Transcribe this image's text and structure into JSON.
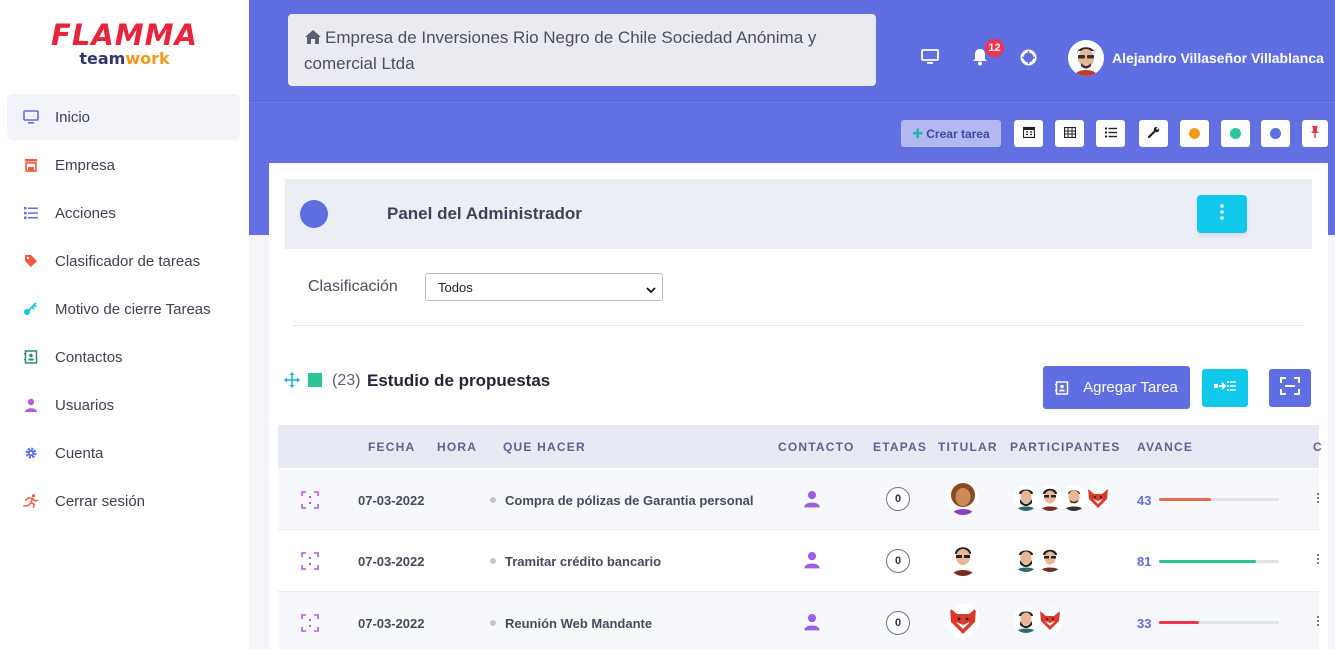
{
  "logo": {
    "brand": "FLAMMA",
    "sub_a": "team",
    "sub_b": "work"
  },
  "sidebar": {
    "items": [
      {
        "label": "Inicio",
        "icon": "monitor-icon",
        "active": true
      },
      {
        "label": "Empresa",
        "icon": "store-icon"
      },
      {
        "label": "Acciones",
        "icon": "list-icon"
      },
      {
        "label": "Clasificador de tareas",
        "icon": "tag-icon"
      },
      {
        "label": "Motivo de cierre Tareas",
        "icon": "key-icon"
      },
      {
        "label": "Contactos",
        "icon": "address-book-icon"
      },
      {
        "label": "Usuarios",
        "icon": "user-icon"
      },
      {
        "label": "Cuenta",
        "icon": "gear-icon"
      },
      {
        "label": "Cerrar sesión",
        "icon": "running-icon"
      }
    ]
  },
  "header": {
    "company": "Empresa de Inversiones Rio Negro de Chile Sociedad Anónima y comercial Ltda",
    "notifications_count": "12",
    "user_name": "Alejandro Villaseñor Villablanca"
  },
  "toolbar": {
    "create_task": "Crear tarea",
    "colors": {
      "accent": "#5f6ee0",
      "orange": "#f39a1d",
      "green": "#2bc59a",
      "blue": "#5f6ee0",
      "red": "#f0334f"
    }
  },
  "panel": {
    "title": "Panel del Administrador"
  },
  "filter": {
    "label": "Clasificación",
    "selected": "Todos"
  },
  "group": {
    "count": "(23)",
    "name": "Estudio de propuestas",
    "add_task": "Agregar Tarea"
  },
  "table": {
    "headers": [
      "FECHA",
      "HORA",
      "QUE HACER",
      "CONTACTO",
      "ETAPAS",
      "TITULAR",
      "PARTICIPANTES",
      "AVANCE",
      "C"
    ],
    "rows": [
      {
        "date": "07-03-2022",
        "hour": "",
        "task": "Compra de pólizas de Garantia personal",
        "stages": "0",
        "progress": 43,
        "progress_label": "43",
        "color": "#f0664a"
      },
      {
        "date": "07-03-2022",
        "hour": "",
        "task": "Tramitar crédito bancario",
        "stages": "0",
        "progress": 81,
        "progress_label": "81",
        "color": "#2bc58a"
      },
      {
        "date": "07-03-2022",
        "hour": "",
        "task": "Reunión Web Mandante",
        "stages": "0",
        "progress": 33,
        "progress_label": "33",
        "color": "#f0334f"
      }
    ]
  }
}
